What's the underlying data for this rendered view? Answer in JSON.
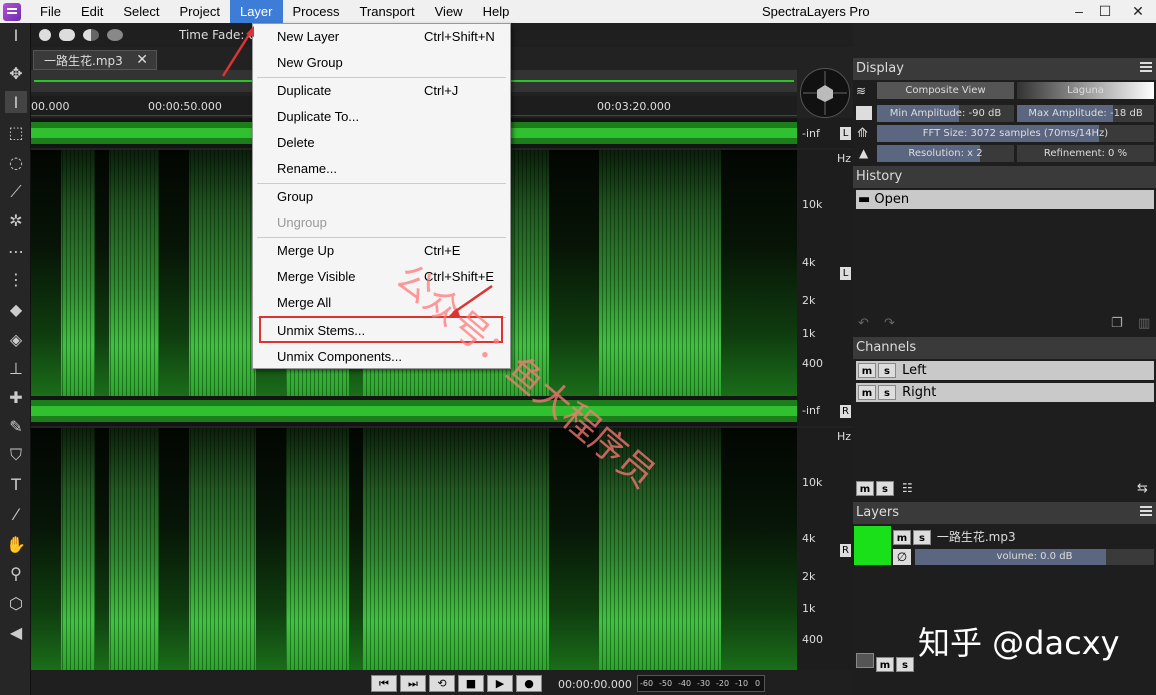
{
  "app": {
    "title": "SpectraLayers Pro"
  },
  "menubar": {
    "items": [
      "File",
      "Edit",
      "Select",
      "Project",
      "Layer",
      "Process",
      "Transport",
      "View",
      "Help"
    ],
    "active": "Layer"
  },
  "optionbar": {
    "time_fade_label": "Time Fade: 0"
  },
  "file_tab": {
    "name": "一路生花.mp3"
  },
  "timeline": {
    "ticks": [
      "00.000",
      "00:00:50.000",
      "00:03:20.000"
    ]
  },
  "waveform": {
    "left_db": "-inf",
    "right_db": "-inf",
    "left_badge": "L",
    "right_badge": "R"
  },
  "freq_axis": {
    "unit": "Hz",
    "labels": [
      "10k",
      "4k",
      "2k",
      "1k",
      "400"
    ]
  },
  "dropdown": {
    "items": [
      {
        "label": "New Layer",
        "shortcut": "Ctrl+Shift+N",
        "disabled": false
      },
      {
        "label": "New Group",
        "shortcut": "",
        "disabled": false
      },
      {
        "label": "Duplicate",
        "shortcut": "Ctrl+J",
        "disabled": false
      },
      {
        "label": "Duplicate To...",
        "shortcut": "",
        "disabled": false
      },
      {
        "label": "Delete",
        "shortcut": "",
        "disabled": false
      },
      {
        "label": "Rename...",
        "shortcut": "",
        "disabled": false
      },
      {
        "label": "Group",
        "shortcut": "",
        "disabled": false
      },
      {
        "label": "Ungroup",
        "shortcut": "",
        "disabled": true
      },
      {
        "label": "Merge Up",
        "shortcut": "Ctrl+E",
        "disabled": false
      },
      {
        "label": "Merge Visible",
        "shortcut": "Ctrl+Shift+E",
        "disabled": false
      },
      {
        "label": "Merge All",
        "shortcut": "",
        "disabled": false
      },
      {
        "label": "Unmix Stems...",
        "shortcut": "",
        "disabled": false
      },
      {
        "label": "Unmix Components...",
        "shortcut": "",
        "disabled": false
      }
    ]
  },
  "display": {
    "title": "Display",
    "composite_view": "Composite View",
    "palette": "Laguna",
    "min_amplitude": "Min Amplitude: -90 dB",
    "max_amplitude": "Max Amplitude: -18 dB",
    "fft_size": "FFT Size: 3072 samples (70ms/14Hz)",
    "resolution": "Resolution: x 2",
    "refinement": "Refinement: 0 %"
  },
  "history": {
    "title": "History",
    "items": [
      "Open"
    ]
  },
  "channels": {
    "title": "Channels",
    "items": [
      "Left",
      "Right"
    ]
  },
  "layers": {
    "title": "Layers",
    "layer_name": "一路生花.mp3",
    "volume": "volume: 0.0 dB"
  },
  "ms": {
    "m": "m",
    "s": "s"
  },
  "transport": {
    "time": "00:00:00.000",
    "meter_labels": [
      "-60",
      "-50",
      "-40",
      "-30",
      "-20",
      "-10",
      "0"
    ]
  },
  "watermark": {
    "text": "公众号：鱼大程序员",
    "zhihu": "知乎 @dacxy"
  },
  "colors": {
    "accent": "#3d7dd8",
    "spectrum": "#2d8b2d",
    "highlight": "#d33333"
  }
}
